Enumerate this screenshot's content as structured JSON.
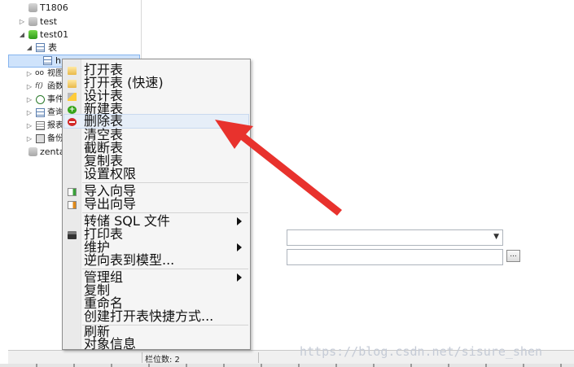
{
  "tree": {
    "items": [
      {
        "label": "T1806",
        "kind": "database-closed"
      },
      {
        "label": "test",
        "kind": "database-closed"
      },
      {
        "label": "test01",
        "kind": "database-open"
      },
      {
        "label": "表",
        "kind": "tables-group"
      },
      {
        "label": "h",
        "kind": "table-selected"
      },
      {
        "label": "视图",
        "kind": "views"
      },
      {
        "label": "函数",
        "kind": "functions"
      },
      {
        "label": "事件",
        "kind": "events"
      },
      {
        "label": "查询",
        "kind": "queries"
      },
      {
        "label": "报表",
        "kind": "reports"
      },
      {
        "label": "备份",
        "kind": "backups"
      },
      {
        "label": "zenta",
        "kind": "database-closed"
      }
    ],
    "func_glyph": "f()"
  },
  "context_menu": {
    "items": [
      {
        "label": "打开表",
        "icon": "folder-open-icon"
      },
      {
        "label": "打开表 (快速)",
        "icon": "folder-open-icon"
      },
      {
        "label": "设计表",
        "icon": "design-icon"
      },
      {
        "label": "新建表",
        "icon": "add-icon"
      },
      {
        "label": "删除表",
        "icon": "delete-icon",
        "highlighted": true
      },
      {
        "label": "清空表"
      },
      {
        "label": "截断表"
      },
      {
        "label": "复制表"
      },
      {
        "label": "设置权限"
      },
      {
        "label": "导入向导",
        "icon": "import-icon"
      },
      {
        "label": "导出向导",
        "icon": "export-icon"
      },
      {
        "label": "转储 SQL 文件",
        "submenu": true
      },
      {
        "label": "打印表",
        "icon": "print-icon"
      },
      {
        "label": "维护",
        "submenu": true
      },
      {
        "label": "逆向表到模型..."
      },
      {
        "label": "管理组",
        "submenu": true
      },
      {
        "label": "复制"
      },
      {
        "label": "重命名"
      },
      {
        "label": "创建打开表快捷方式..."
      },
      {
        "label": "刷新"
      },
      {
        "label": "对象信息"
      }
    ],
    "add_glyph": "+"
  },
  "right_panel": {
    "combo_value": "",
    "combo_arrow": "▼",
    "field_value": "",
    "browse_label": "..."
  },
  "status_bar": {
    "column_count": "栏位数: 2"
  },
  "watermark": "https://blog.csdn.net/sisure_shen",
  "colors": {
    "arrow": "#e8322d",
    "highlight": "#e6eef8"
  }
}
